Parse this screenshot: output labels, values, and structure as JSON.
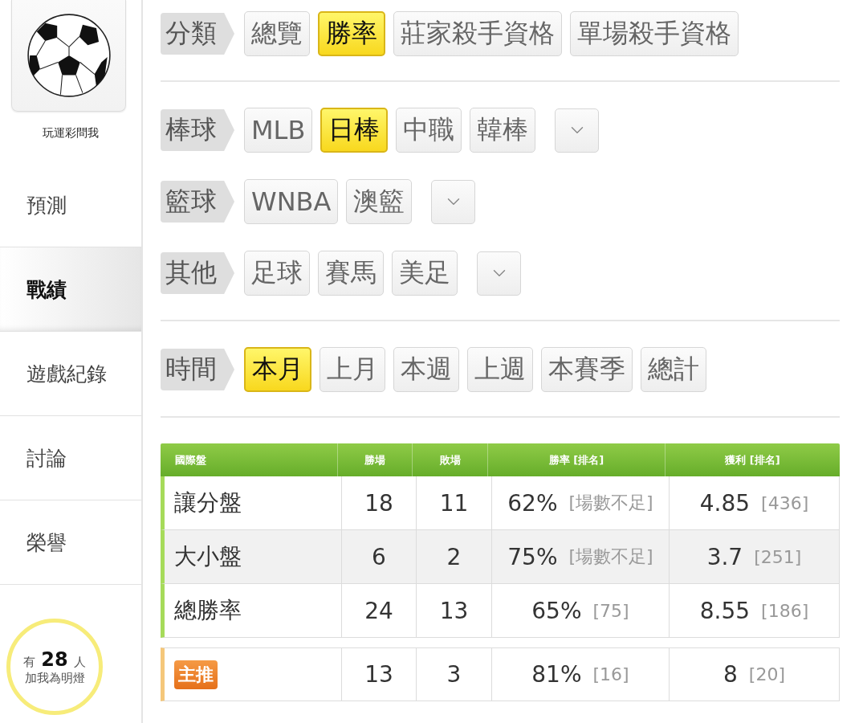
{
  "sidebar": {
    "avatar_caption": "玩運彩問我",
    "items": [
      {
        "label": "預測",
        "selected": false
      },
      {
        "label": "戰績",
        "selected": true
      },
      {
        "label": "遊戲紀錄",
        "selected": false
      },
      {
        "label": "討論",
        "selected": false
      },
      {
        "label": "榮譽",
        "selected": false
      }
    ],
    "fans": {
      "prefix": "有",
      "count": "28",
      "suffix": "人",
      "caption": "加我為明燈"
    }
  },
  "filter_sections": [
    [
      {
        "label": "分類",
        "options": [
          {
            "label": "總覽",
            "selected": false
          },
          {
            "label": "勝率",
            "selected": true
          },
          {
            "label": "莊家殺手資格",
            "selected": false
          },
          {
            "label": "單場殺手資格",
            "selected": false
          }
        ],
        "has_more": false
      }
    ],
    [
      {
        "label": "棒球",
        "options": [
          {
            "label": "MLB",
            "selected": false
          },
          {
            "label": "日棒",
            "selected": true
          },
          {
            "label": "中職",
            "selected": false
          },
          {
            "label": "韓棒",
            "selected": false
          }
        ],
        "has_more": true
      },
      {
        "label": "籃球",
        "options": [
          {
            "label": "WNBA",
            "selected": false
          },
          {
            "label": "澳籃",
            "selected": false
          }
        ],
        "has_more": true
      },
      {
        "label": "其他",
        "options": [
          {
            "label": "足球",
            "selected": false
          },
          {
            "label": "賽馬",
            "selected": false
          },
          {
            "label": "美足",
            "selected": false
          }
        ],
        "has_more": true
      }
    ],
    [
      {
        "label": "時間",
        "options": [
          {
            "label": "本月",
            "selected": true
          },
          {
            "label": "上月",
            "selected": false
          },
          {
            "label": "本週",
            "selected": false
          },
          {
            "label": "上週",
            "selected": false
          },
          {
            "label": "本賽季",
            "selected": false
          },
          {
            "label": "總計",
            "selected": false
          }
        ],
        "has_more": false
      }
    ]
  ],
  "table": {
    "columns": [
      "國際盤",
      "勝場",
      "敗場",
      "勝率 [排名]",
      "獲利 [排名]"
    ],
    "rows": [
      {
        "kind": "standard",
        "label": "讓分盤",
        "wins": "18",
        "losses": "11",
        "rate": "62%",
        "rate_rank": "[場數不足]",
        "profit": "4.85",
        "profit_rank": "[436]"
      },
      {
        "kind": "standard",
        "label": "大小盤",
        "wins": "6",
        "losses": "2",
        "rate": "75%",
        "rate_rank": "[場數不足]",
        "profit": "3.7",
        "profit_rank": "[251]"
      },
      {
        "kind": "standard",
        "label": "總勝率",
        "wins": "24",
        "losses": "13",
        "rate": "65%",
        "rate_rank": "[75]",
        "profit": "8.55",
        "profit_rank": "[186]"
      },
      {
        "kind": "featured",
        "label": "主推",
        "wins": "13",
        "losses": "3",
        "rate": "81%",
        "rate_rank": "[16]",
        "profit": "8",
        "profit_rank": "[20]"
      }
    ]
  }
}
